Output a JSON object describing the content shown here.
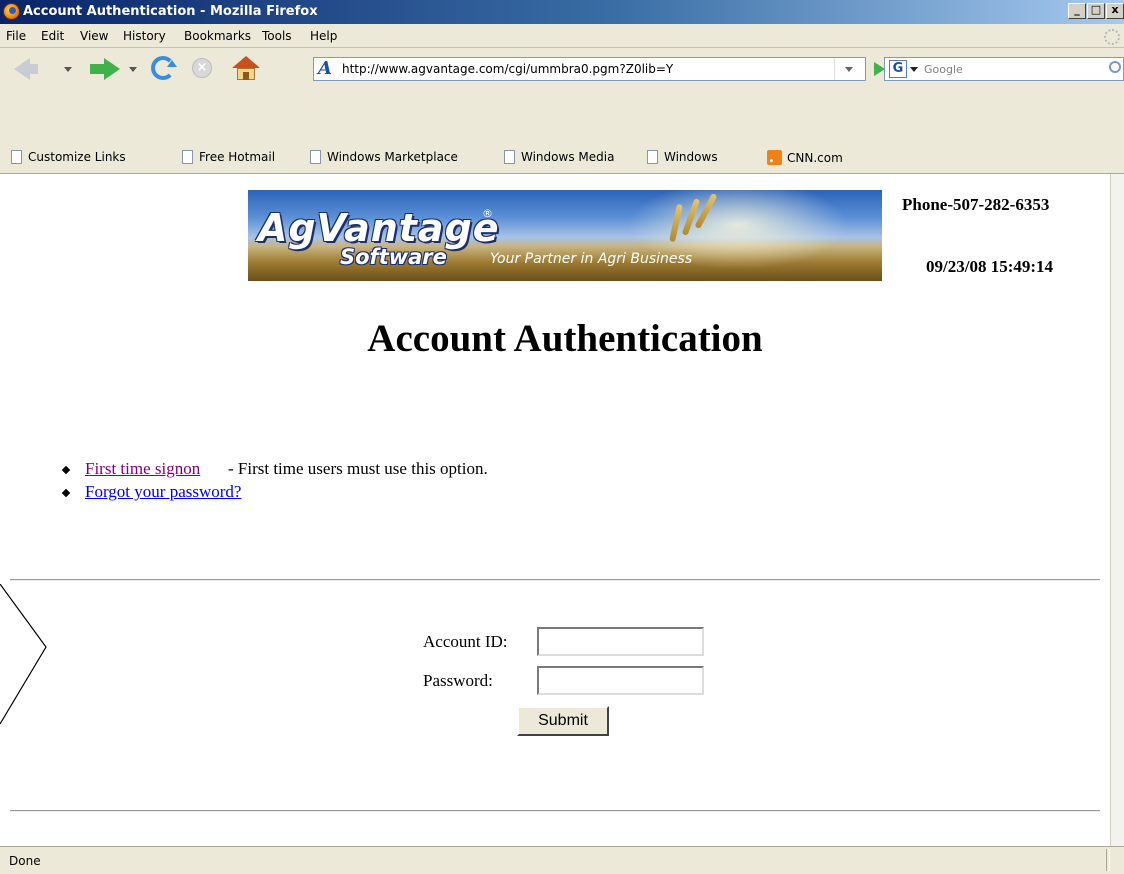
{
  "window": {
    "title": "Account Authentication - Mozilla Firefox",
    "controls": [
      "_",
      "□",
      "x"
    ]
  },
  "menu": {
    "items": [
      {
        "label": "File"
      },
      {
        "label": "Edit"
      },
      {
        "label": "View"
      },
      {
        "label": "History"
      },
      {
        "label": "Bookmarks"
      },
      {
        "label": "Tools"
      },
      {
        "label": "Help"
      }
    ]
  },
  "navigation": {
    "url": "http://www.agvantage.com/cgi/ummbra0.pgm?Z0lib=Y",
    "search_placeholder": "Google",
    "search_engine_icon": "G"
  },
  "bookmarks": [
    {
      "label": "Customize Links",
      "icon": "page-icon"
    },
    {
      "label": "Free Hotmail",
      "icon": "page-icon"
    },
    {
      "label": "Windows Marketplace",
      "icon": "page-icon"
    },
    {
      "label": "Windows Media",
      "icon": "page-icon"
    },
    {
      "label": "Windows",
      "icon": "page-icon"
    },
    {
      "label": "CNN.com",
      "icon": "rss-icon"
    }
  ],
  "page": {
    "banner": {
      "brand": "AgVantage",
      "registered": "®",
      "brand_sub": "Software",
      "tagline": "Your Partner in Agri Business"
    },
    "phone": "Phone-507-282-6353",
    "datetime": "09/23/08 15:49:14",
    "title": "Account Authentication",
    "options": [
      {
        "link": "First time signon",
        "description": " - First time users must use this option.",
        "visited": true
      },
      {
        "link": "Forgot your password?",
        "description": "",
        "visited": false
      }
    ],
    "form": {
      "account_label": "Account ID:",
      "account_value": "",
      "password_label": "Password:",
      "password_value": "",
      "submit_label": "Submit"
    }
  },
  "status": {
    "text": "Done"
  }
}
